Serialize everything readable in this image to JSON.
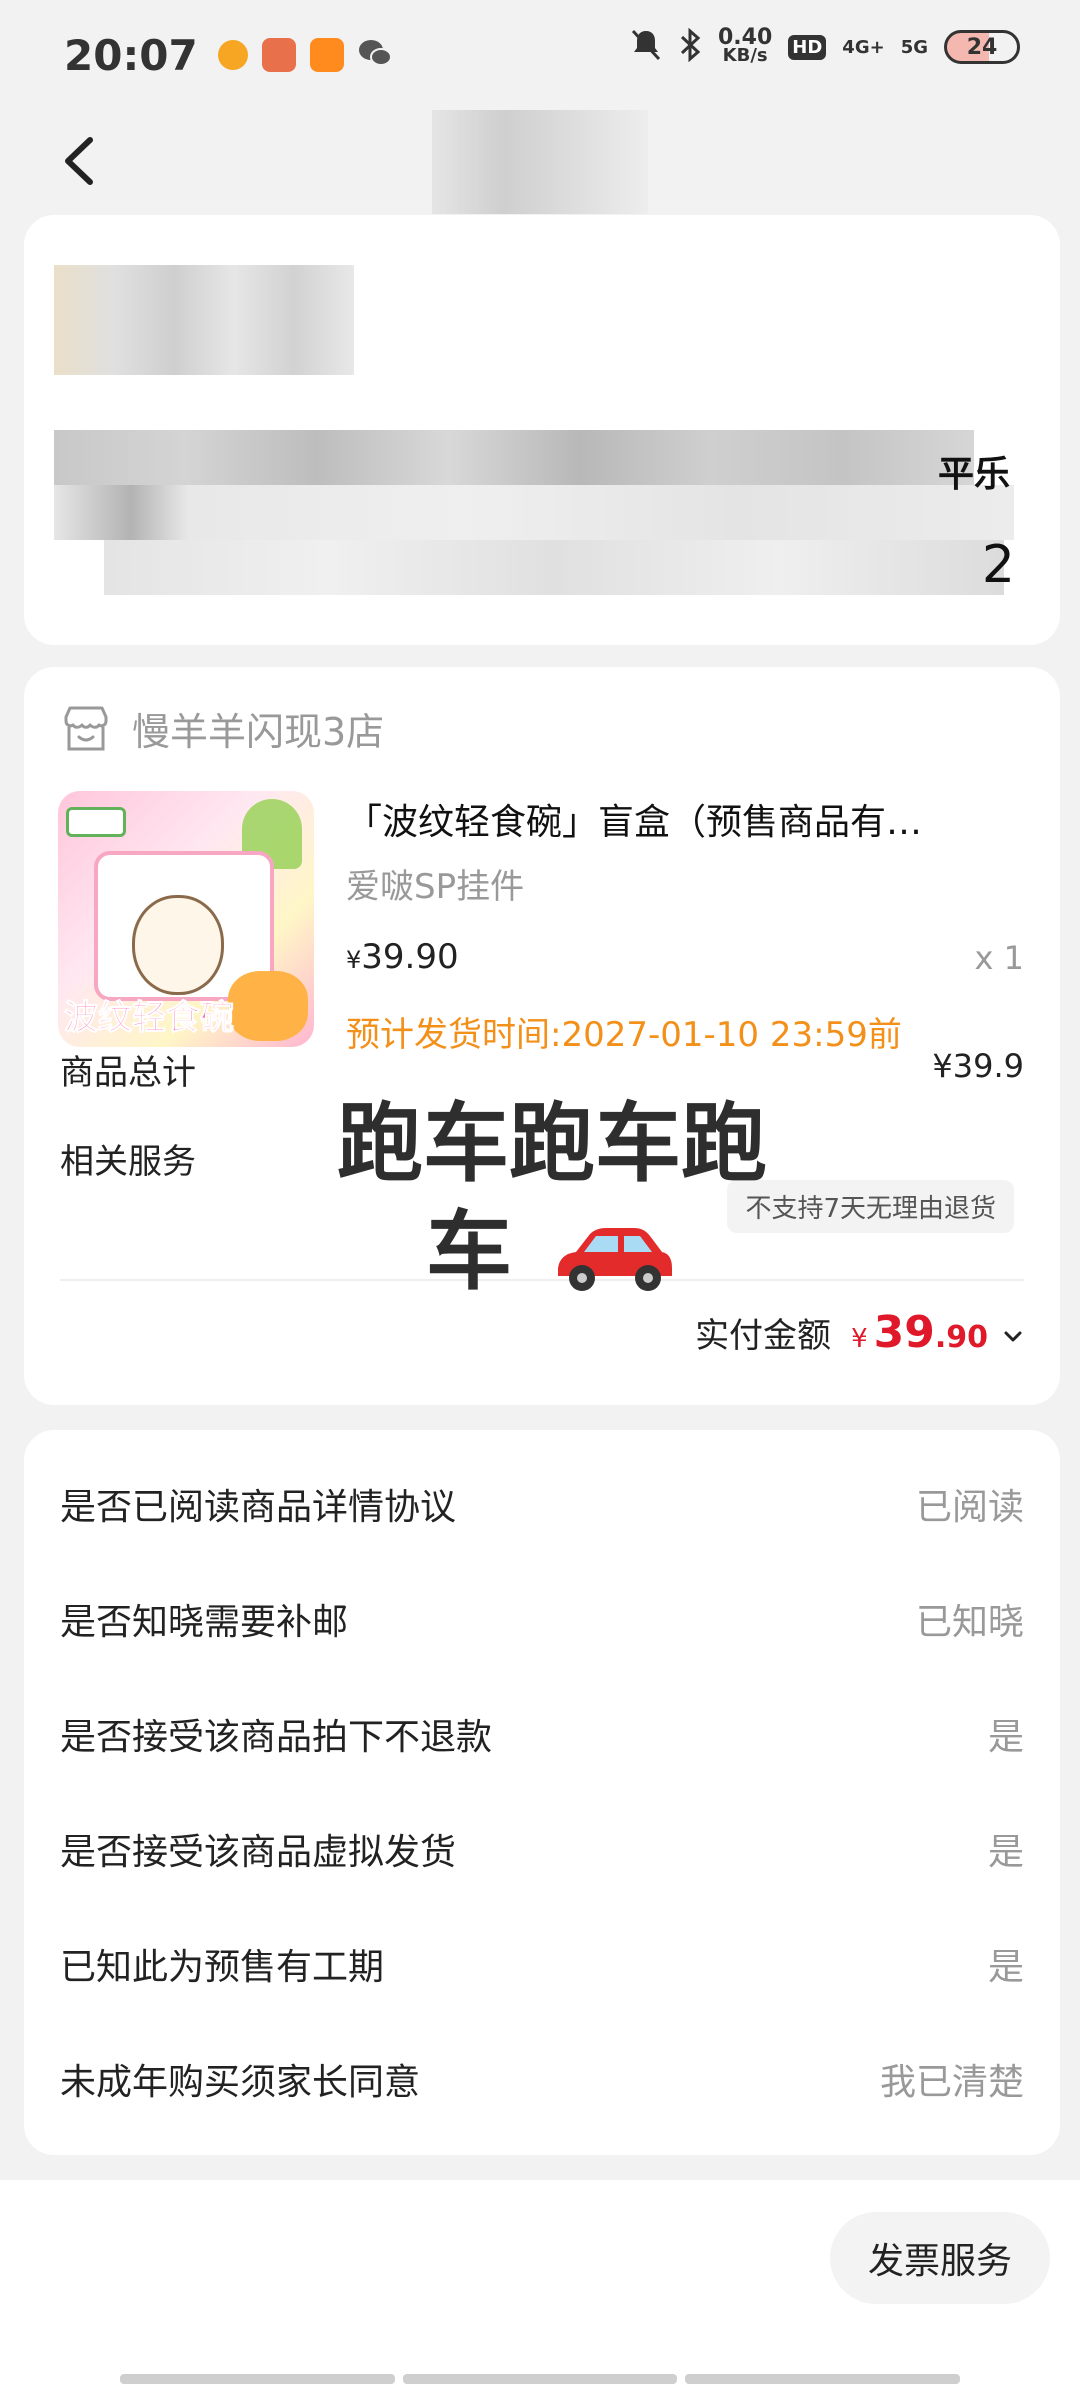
{
  "status_bar": {
    "time": "20:07",
    "net_speed_value": "0.40",
    "net_speed_unit": "KB/s",
    "hd": "HD",
    "sim1": "4G+",
    "sim2": "5G",
    "battery": "24"
  },
  "address": {
    "tail_line1": "平乐",
    "tail_line2": "2"
  },
  "order": {
    "store_name": "慢羊羊闪现3店",
    "product_title": "「波纹轻食碗」盲盒（预售商品有…",
    "product_sub": "爱啵SP挂件",
    "price_yen": "¥",
    "price": "39.90",
    "qty": "x 1",
    "ship_time": "预计发货时间:2027-01-10 23:59前",
    "total_label": "商品总计",
    "total_value": "¥39.9",
    "service_label": "相关服务",
    "service_tag": "不支持7天无理由退货",
    "paid_label": "实付金额",
    "paid_yen": "¥",
    "paid_int": "39",
    "paid_dec": ".90",
    "overlay_line1": "跑车跑车跑",
    "overlay_line2": "车"
  },
  "agreements": [
    {
      "q": "是否已阅读商品详情协议",
      "a": "已阅读"
    },
    {
      "q": "是否知晓需要补邮",
      "a": "已知晓"
    },
    {
      "q": "是否接受该商品拍下不退款",
      "a": "是"
    },
    {
      "q": "是否接受该商品虚拟发货",
      "a": "是"
    },
    {
      "q": "已知此为预售有工期",
      "a": "是"
    },
    {
      "q": "未成年购买须家长同意",
      "a": "我已清楚"
    }
  ],
  "bottom": {
    "invoice_label": "发票服务"
  },
  "colors": {
    "price_red": "#e0192a",
    "ship_orange": "#f2901a",
    "background": "#f2f2f2"
  }
}
